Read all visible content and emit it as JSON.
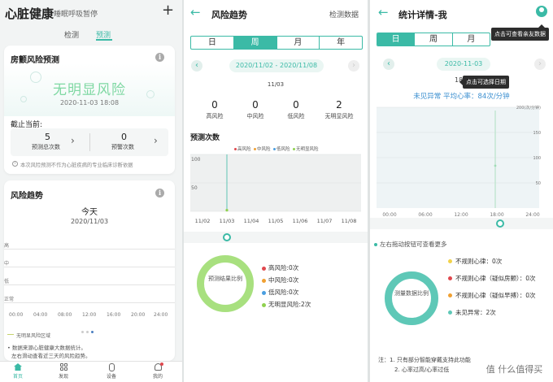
{
  "colors": {
    "accent": "#3bbaa6",
    "high": "#e0484e",
    "mid": "#f0a032",
    "low": "#4a9ee0",
    "none": "#8fd14f"
  },
  "p1": {
    "title": "心脏健康",
    "subtitle": "睡眠呼吸暂停",
    "add": "+",
    "tabs": [
      "检测",
      "预测"
    ],
    "risk_card": {
      "title": "房颤风险预测",
      "status": "无明显风险",
      "time": "2020-11-03 18:08",
      "as_of": "截止当前:",
      "stats": [
        {
          "value": "5",
          "label": "预测总次数"
        },
        {
          "value": "0",
          "label": "预警次数"
        }
      ],
      "disclaimer": "本次风险预测不作为心脏疾病的专业临床诊断依据"
    },
    "trend_card": {
      "title": "风险趋势",
      "period": "今天",
      "date": "2020/11/03",
      "levels": [
        "高",
        "中",
        "低",
        "正常"
      ],
      "times": [
        "00:00",
        "04:00",
        "08:00",
        "12:00",
        "16:00",
        "20:00",
        "24:00"
      ],
      "legend": "无明显风险区域",
      "notes": [
        "数据来源心脏健康大数据统计。",
        "左右滑动查看近三天的风险趋势。"
      ]
    },
    "nav": [
      {
        "label": "首页",
        "icon": "home-icon"
      },
      {
        "label": "发现",
        "icon": "grid-icon"
      },
      {
        "label": "设备",
        "icon": "watch-icon"
      },
      {
        "label": "我的",
        "icon": "user-icon"
      }
    ]
  },
  "p2": {
    "back": "←",
    "title": "风险趋势",
    "action": "检测数据",
    "seg": [
      "日",
      "周",
      "月",
      "年"
    ],
    "range": "2020/11/02 - 2020/11/08",
    "date": "11/03",
    "stats": [
      {
        "value": "0",
        "label": "高风险"
      },
      {
        "value": "0",
        "label": "中风险"
      },
      {
        "value": "0",
        "label": "低风险"
      },
      {
        "value": "2",
        "label": "无明显风险"
      }
    ],
    "chart_title": "预测次数",
    "legend": [
      "高风险",
      "中风险",
      "低风险",
      "无明显风险"
    ],
    "donut_label": "预测结果比例",
    "results": [
      {
        "label": "高风险:",
        "value": "0次"
      },
      {
        "label": "中风险:",
        "value": "0次"
      },
      {
        "label": "低风险:",
        "value": "0次"
      },
      {
        "label": "无明显风险:",
        "value": "2次"
      }
    ]
  },
  "p3": {
    "back": "←",
    "title": "统计详情-我",
    "seg": [
      "日",
      "周",
      "月"
    ],
    "date": "2020-11-03",
    "tip_friends": "点击可查看亲友数据",
    "tip_date": "点击可选择日期",
    "date_prefix": "18",
    "summary": "未见异常  平均心率：84次/分钟",
    "y_unit": "200(次/分钟)",
    "hint": "左右拖动按钮可查看更多",
    "donut_label": "测量数据比例",
    "results": [
      {
        "label": "不规则心律：0次"
      },
      {
        "label": "不规则心律（疑似房颤）：0次"
      },
      {
        "label": "不规则心律（疑似早搏）：0次"
      },
      {
        "label": "未见异常：2次"
      }
    ],
    "notes": [
      "注：1. 只有部分智能穿戴支持此功能",
      "2. 心率过高/心率过低"
    ],
    "watermark": "值 什么值得买"
  },
  "chart_data": [
    {
      "type": "bar",
      "title": "预测次数",
      "categories": [
        "11/02",
        "11/03",
        "11/04",
        "11/05",
        "11/06",
        "11/07",
        "11/08"
      ],
      "series": [
        {
          "name": "高风险",
          "values": [
            0,
            0,
            0,
            0,
            0,
            0,
            0
          ]
        },
        {
          "name": "中风险",
          "values": [
            0,
            0,
            0,
            0,
            0,
            0,
            0
          ]
        },
        {
          "name": "低风险",
          "values": [
            0,
            0,
            0,
            0,
            0,
            0,
            0
          ]
        },
        {
          "name": "无明显风险",
          "values": [
            0,
            2,
            0,
            0,
            0,
            0,
            0
          ]
        }
      ],
      "y_ticks": [
        "100",
        "50",
        "0"
      ],
      "ylim": [
        0,
        100
      ]
    },
    {
      "type": "line",
      "title": "",
      "x_ticks": [
        "00:00",
        "06:00",
        "12:00",
        "18:00",
        "24:00"
      ],
      "y_ticks": [
        "200(次/分钟)",
        "150",
        "100",
        "50"
      ],
      "ylim": [
        0,
        200
      ]
    }
  ]
}
